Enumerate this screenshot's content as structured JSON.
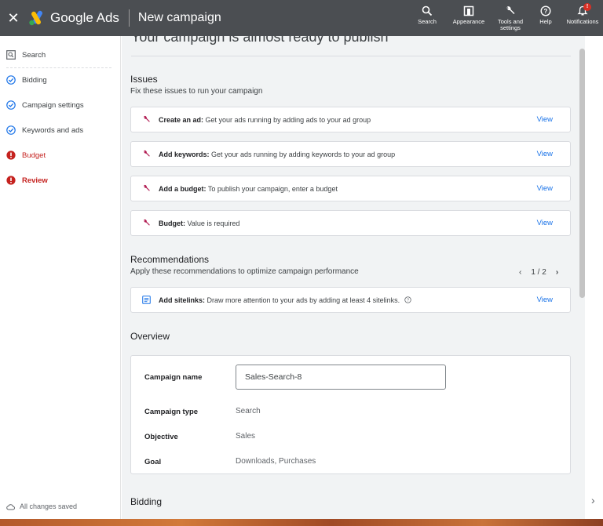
{
  "header": {
    "brand": "Google Ads",
    "page_title": "New campaign",
    "actions": {
      "search": "Search",
      "appearance": "Appearance",
      "tools_line1": "Tools and",
      "tools_line2": "settings",
      "help": "Help",
      "notifications": "Notifications",
      "notification_badge": "!"
    }
  },
  "sidebar": {
    "items": [
      {
        "label": "Search",
        "icon": "search-box-icon",
        "state": "normal"
      },
      {
        "label": "Bidding",
        "icon": "check-circle-icon",
        "state": "done"
      },
      {
        "label": "Campaign settings",
        "icon": "check-circle-icon",
        "state": "done"
      },
      {
        "label": "Keywords and ads",
        "icon": "check-circle-icon",
        "state": "done"
      },
      {
        "label": "Budget",
        "icon": "error-icon",
        "state": "error"
      },
      {
        "label": "Review",
        "icon": "error-icon",
        "state": "error-current"
      }
    ],
    "status": "All changes saved"
  },
  "main": {
    "title": "Your campaign is almost ready to publish",
    "issues": {
      "heading": "Issues",
      "subheading": "Fix these issues to run your campaign",
      "items": [
        {
          "title": "Create an ad:",
          "text": " Get your ads running by adding ads to your ad group",
          "action": "View"
        },
        {
          "title": "Add keywords:",
          "text": " Get your ads running by adding keywords to your ad group",
          "action": "View"
        },
        {
          "title": "Add a budget:",
          "text": " To publish your campaign, enter a budget",
          "action": "View"
        },
        {
          "title": "Budget:",
          "text": " Value is required",
          "action": "View"
        }
      ]
    },
    "recommendations": {
      "heading": "Recommendations",
      "subheading": "Apply these recommendations to optimize campaign performance",
      "pager": "1 / 2",
      "items": [
        {
          "title": "Add sitelinks:",
          "text": " Draw more attention to your ads by adding at least 4 sitelinks.",
          "action": "View"
        }
      ]
    },
    "overview": {
      "heading": "Overview",
      "campaign_name_label": "Campaign name",
      "campaign_name_value": "Sales-Search-8",
      "campaign_type_label": "Campaign type",
      "campaign_type_value": "Search",
      "objective_label": "Objective",
      "objective_value": "Sales",
      "goal_label": "Goal",
      "goal_value": "Downloads, Purchases"
    },
    "bidding": {
      "heading": "Bidding"
    }
  },
  "colors": {
    "topbar": "#4b4e52",
    "link": "#1a73e8",
    "error": "#c5221f",
    "done": "#1a73e8",
    "wrench": "#b0174f"
  }
}
